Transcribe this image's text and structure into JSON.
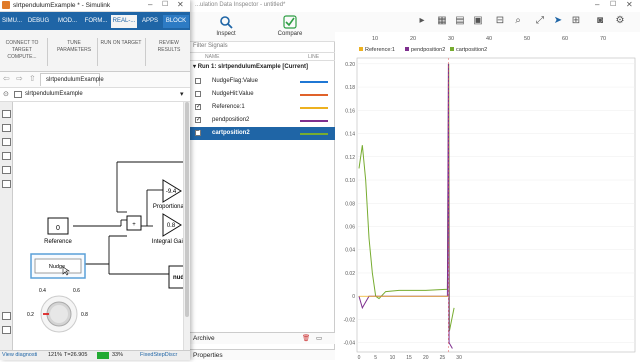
{
  "simulink": {
    "title": "slrtpendulumExample * - Simulink",
    "tabs": [
      "SIMU...",
      "DEBUG",
      "MOD...",
      "FORM...",
      "REAL-...",
      "APPS",
      "BLOCK"
    ],
    "ribbon": {
      "connect_label": "CONNECT TO TARGET COMPUTE...",
      "tune_label": "TUNE PARAMETERS",
      "run_label": "RUN ON TARGET",
      "review_label": "REVIEW RESULTS"
    },
    "tab_breadcrumb": "slrtpendulumExample",
    "address": "slrtpendulumExample",
    "blocks": {
      "reference_value": "0",
      "reference_label": "Reference",
      "nudge_button": "Nudge",
      "proportional_gain": "-9.4",
      "proportional_label": "Proportional",
      "integral_gain": "0.8",
      "integral_label": "Integral Gain",
      "nudge_display": "nud da",
      "knob_labels": [
        "0.4",
        "0.6",
        "0.2",
        "0.8"
      ]
    },
    "status": {
      "left": "View diagnosti",
      "zoom": "121%",
      "time": "T=26.905",
      "progress_text": "33%",
      "progress": 33,
      "solver": "FixedStepDiscr"
    }
  },
  "sdi": {
    "title": "...ulation Data Inspector - untitled*",
    "inspect_label": "Inspect",
    "compare_label": "Compare",
    "filter_label": "Filter Signals",
    "col_name": "NAME",
    "col_line": "LINE",
    "run_label": "Run 1: slrtpendulumExample [Current]",
    "signals": [
      {
        "name": "NudgeFlag:Value",
        "checked": false,
        "color": "#1f77d4",
        "selected": false
      },
      {
        "name": "NudgeHit:Value",
        "checked": false,
        "color": "#e0622a",
        "selected": false
      },
      {
        "name": "Reference:1",
        "checked": true,
        "color": "#edb120",
        "selected": false
      },
      {
        "name": "pendposition2",
        "checked": true,
        "color": "#7e2f8e",
        "selected": false
      },
      {
        "name": "cartposition2",
        "checked": true,
        "color": "#77ac30",
        "selected": true
      }
    ],
    "archive_label": "Archive",
    "properties_label": "Properties",
    "legend": [
      "Reference:1",
      "pendposition2",
      "cartposition2"
    ],
    "top_axis_ticks": [
      "10",
      "20",
      "30",
      "40",
      "50",
      "60",
      "70"
    ],
    "y_ticks": [
      "0.20",
      "0.18",
      "0.16",
      "0.14",
      "0.12",
      "0.10",
      "0.08",
      "0.06",
      "0.04",
      "0.02",
      "0",
      "-0.02",
      "-0.04"
    ],
    "x_ticks": [
      "0",
      "5",
      "10",
      "15",
      "20",
      "25",
      "30"
    ]
  },
  "colors": {
    "accent": "#1f65a6",
    "reference": "#edb120",
    "pend": "#7e2f8e",
    "cart": "#77ac30",
    "selected_row": "#1f65a6"
  }
}
